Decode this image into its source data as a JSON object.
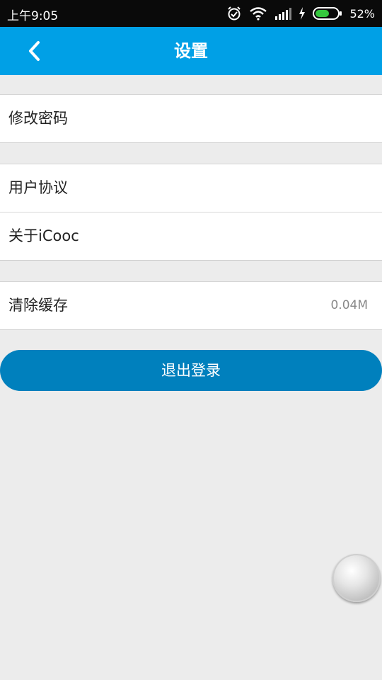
{
  "status_bar": {
    "time": "上午9:05",
    "battery_percent": "52%",
    "icons": [
      "alarm-icon",
      "wifi-icon",
      "signal-icon",
      "charging-icon",
      "battery-icon"
    ]
  },
  "header": {
    "title": "设置",
    "back_icon": "chevron-left-icon"
  },
  "settings": {
    "change_password": "修改密码",
    "user_agreement": "用户协议",
    "about": "关于iCooc",
    "clear_cache": "清除缓存",
    "cache_size": "0.04M"
  },
  "logout_label": "退出登录",
  "colors": {
    "header": "#00a0e6",
    "logout_button": "#0080bd",
    "background": "#ececec"
  }
}
